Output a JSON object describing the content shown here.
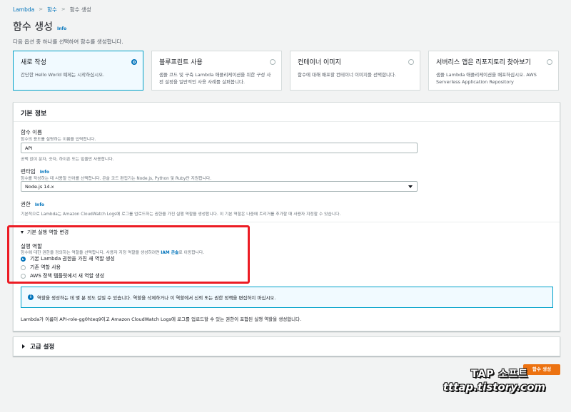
{
  "breadcrumb": {
    "root": "Lambda",
    "sep": ">",
    "section": "함수",
    "current": "함수 생성"
  },
  "header": {
    "title": "함수 생성",
    "info": "Info",
    "description": "다음 옵션 중 하나를 선택하여 함수를 생성합니다."
  },
  "options": [
    {
      "title": "새로 작성",
      "desc": "간단한 Hello World 예제는 시작하십시오.",
      "selected": true
    },
    {
      "title": "블루프린트 사용",
      "desc": "샘플 코드 및 구축 Lambda 애플리케이션을 위한 구성 사전 설정을 일반적인 사용 사례를 살펴봅니다.",
      "selected": false
    },
    {
      "title": "컨테이너 이미지",
      "desc": "함수에 대해 배포할 컨테이너 이미지를 선택합니다.",
      "selected": false
    },
    {
      "title": "서버리스 앱은 리포지토리 찾아보기",
      "desc": "샘플 Lambda 애플리케이션을 배포하십시오. AWS Serverless Application Repository",
      "selected": false
    }
  ],
  "basic": {
    "header": "기본 정보",
    "function_name_label": "함수 이름",
    "function_name_help": "함수의 용도를 설명하는 이름을 입력합니다.",
    "function_name_value": "API",
    "function_name_constraint": "공백 없이 문자, 숫자, 하이픈 또는 밑줄만 사용합니다.",
    "runtime_label": "런타임",
    "runtime_info": "Info",
    "runtime_help": "함수를 작성하는 데 사용할 언어를 선택합니다. 콘솔 코드 편집기는 Node.js, Python 및 Ruby만 지원합니다.",
    "runtime_value": "Node.js 14.x",
    "permission_label": "권한",
    "permission_info": "Info",
    "permission_help": "기본적으로 Lambda는 Amazon CloudWatch Logs에 로그를 업로드하는 권한을 가진 실행 역할을 생성합니다. 이 기본 역할은 나중에 트리거를 추가할 때 사용자 지정할 수 있습니다.",
    "exec_role_toggle": "기본 실행 역할 변경",
    "exec_role_label": "실행 역할",
    "exec_role_help_prefix": "함수에 대한 권한을 정의하는 역할을 선택합니다. 사용자 지정 역할을 생성하려면 ",
    "exec_role_help_link": "IAM 콘솔",
    "exec_role_help_suffix": "로 이동합니다.",
    "role_options": [
      {
        "label": "기본 Lambda 권한을 가진 새 역할 생성",
        "selected": true
      },
      {
        "label": "기존 역할 사용",
        "selected": false
      },
      {
        "label": "AWS 정책 템플릿에서 새 역할 생성",
        "selected": false
      }
    ],
    "alert_text": "역할을 생성하는 데 몇 분 정도 걸릴 수 있습니다. 역할을 삭제하거나 이 역할에서 신뢰 또는 권한 정책을 편집하지 마십시오.",
    "summary_text": "Lambda가 이름이 API-role-gg0hteq9이고 Amazon CloudWatch Logs에 로그를 업로드할 수 있는 권한이 포함된 실행 역할을 생성합니다."
  },
  "advanced": {
    "header": "고급 설정"
  },
  "actions": {
    "create": "함수 생성"
  },
  "watermark": {
    "line1": "TAP 소프트",
    "line2": "tttap.tistory.com"
  },
  "colors": {
    "accent": "#0073bb",
    "primary_button": "#ec7211",
    "highlight_border": "#ec1c24",
    "selected_tile": "#f1faff"
  }
}
